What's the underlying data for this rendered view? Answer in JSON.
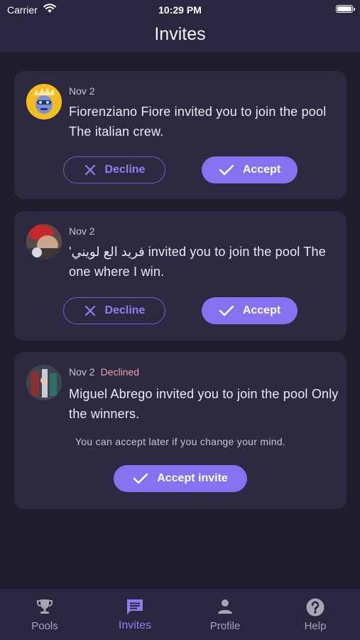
{
  "status_bar": {
    "carrier": "Carrier",
    "time": "10:29 PM"
  },
  "header": {
    "title": "Invites"
  },
  "invites": [
    {
      "date": "Nov 2",
      "message": "Fiorenziano Fiore invited you to join the pool The italian crew.",
      "decline_label": "Decline",
      "accept_label": "Accept"
    },
    {
      "date": "Nov 2",
      "message": "'فريد الع لويني invited you to join the pool The one where I win.",
      "decline_label": "Decline",
      "accept_label": "Accept"
    },
    {
      "date": "Nov 2",
      "status": "Declined",
      "message": "Miguel Abrego invited you to join the pool Only the winners.",
      "hint": "You can accept later if you change your mind.",
      "accept_label": "Accept invite"
    }
  ],
  "tabs": [
    {
      "label": "Pools",
      "icon": "trophy-icon"
    },
    {
      "label": "Invites",
      "icon": "message-icon",
      "active": true
    },
    {
      "label": "Profile",
      "icon": "person-icon"
    },
    {
      "label": "Help",
      "icon": "help-icon"
    }
  ],
  "colors": {
    "background": "#211d2d",
    "surface": "#2d2940",
    "bar": "#2b2640",
    "accent": "#8671f0",
    "declined": "#f0a0a6"
  }
}
